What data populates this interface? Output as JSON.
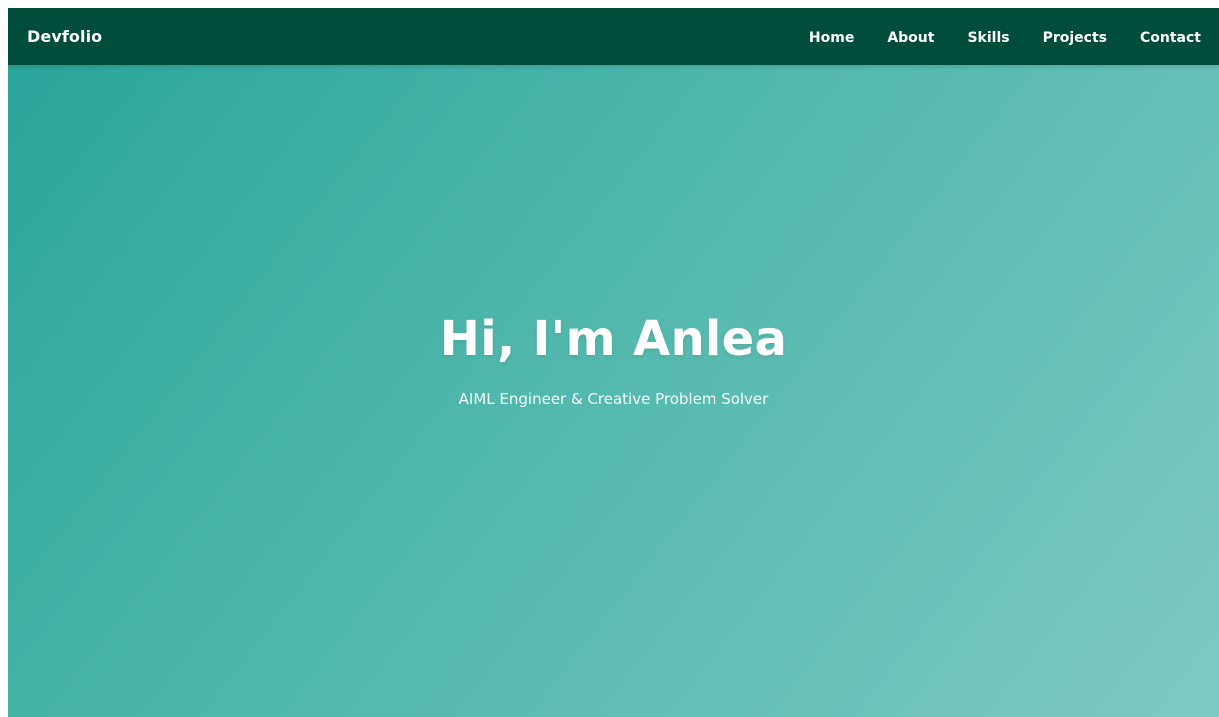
{
  "navbar": {
    "brand": "Devfolio",
    "links": [
      {
        "label": "Home"
      },
      {
        "label": "About"
      },
      {
        "label": "Skills"
      },
      {
        "label": "Projects"
      },
      {
        "label": "Contact"
      }
    ]
  },
  "hero": {
    "title": "Hi, I'm Anlea",
    "subtitle": "AIML Engineer & Creative Problem Solver"
  },
  "colors": {
    "navbar_bg": "#014d3c",
    "hero_gradient_start": "#2aa59b",
    "hero_gradient_end": "#7ecac2",
    "text": "#ffffff"
  }
}
